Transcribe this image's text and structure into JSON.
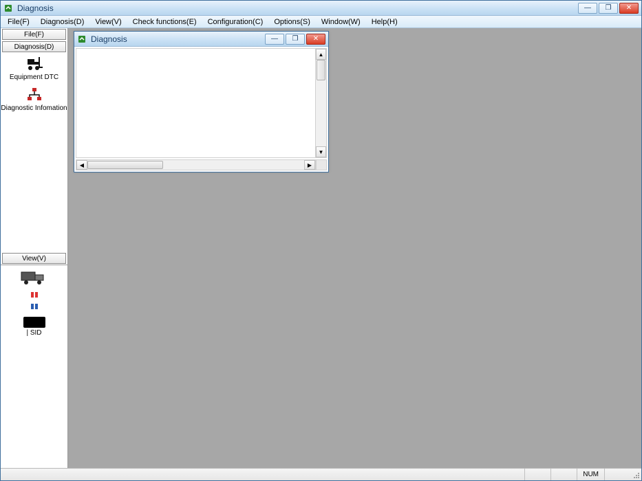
{
  "window": {
    "title": "Diagnosis",
    "controls": {
      "minimize_glyph": "—",
      "maximize_glyph": "❐",
      "close_glyph": "✕"
    }
  },
  "menu": {
    "items": [
      "File(F)",
      "Diagnosis(D)",
      "View(V)",
      "Check functions(E)",
      "Configuration(C)",
      "Options(S)",
      "Window(W)",
      "Help(H)"
    ]
  },
  "sidebar": {
    "buttons": {
      "file": "File(F)",
      "diagnosis": "Diagnosis(D)",
      "view": "View(V)"
    },
    "diag_items": [
      {
        "icon": "forklift-icon",
        "label": "Equipment DTC"
      },
      {
        "icon": "hierarchy-icon",
        "label": "Diagnostic Infomation"
      }
    ],
    "view_pane": {
      "sid_label": "| SID"
    }
  },
  "child_window": {
    "title": "Diagnosis",
    "controls": {
      "minimize_glyph": "—",
      "restore_glyph": "❐",
      "close_glyph": "✕"
    }
  },
  "statusbar": {
    "num": "NUM"
  }
}
